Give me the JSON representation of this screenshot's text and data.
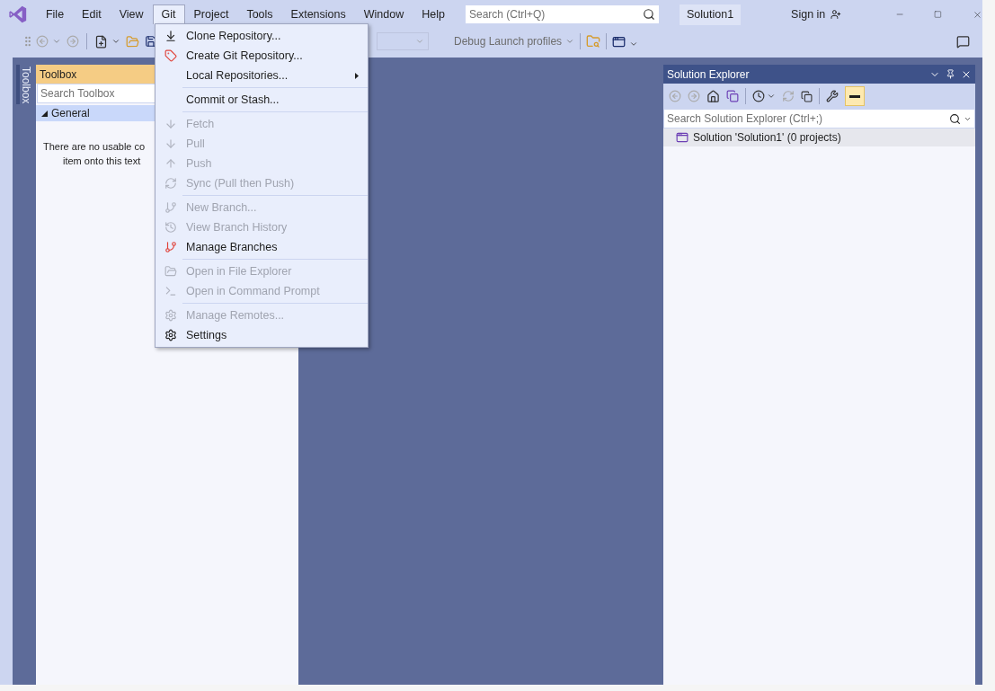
{
  "title_bar": {
    "menus": [
      {
        "label": "File",
        "selected": false
      },
      {
        "label": "Edit",
        "selected": false
      },
      {
        "label": "View",
        "selected": false
      },
      {
        "label": "Git",
        "selected": true
      },
      {
        "label": "Project",
        "selected": false
      },
      {
        "label": "Tools",
        "selected": false
      },
      {
        "label": "Extensions",
        "selected": false
      },
      {
        "label": "Window",
        "selected": false
      },
      {
        "label": "Help",
        "selected": false
      }
    ],
    "search": {
      "placeholder": "Search (Ctrl+Q)"
    },
    "solution_name": "Solution1",
    "sign_in": "Sign in"
  },
  "toolbar": {
    "launch_profiles": "Debug Launch profiles"
  },
  "git_menu": {
    "groups": [
      [
        {
          "label": "Clone Repository...",
          "disabled": false,
          "submenu": false
        },
        {
          "label": "Create Git Repository...",
          "disabled": false,
          "submenu": false
        },
        {
          "label": "Local Repositories...",
          "disabled": false,
          "submenu": true
        }
      ],
      [
        {
          "label": "Commit or Stash...",
          "disabled": false,
          "submenu": false
        }
      ],
      [
        {
          "label": "Fetch",
          "disabled": true,
          "submenu": false
        },
        {
          "label": "Pull",
          "disabled": true,
          "submenu": false
        },
        {
          "label": "Push",
          "disabled": true,
          "submenu": false
        },
        {
          "label": "Sync (Pull then Push)",
          "disabled": true,
          "submenu": false
        }
      ],
      [
        {
          "label": "New Branch...",
          "disabled": true,
          "submenu": false
        },
        {
          "label": "View Branch History",
          "disabled": true,
          "submenu": false
        },
        {
          "label": "Manage Branches",
          "disabled": false,
          "submenu": false
        }
      ],
      [
        {
          "label": "Open in File Explorer",
          "disabled": true,
          "submenu": false
        },
        {
          "label": "Open in Command Prompt",
          "disabled": true,
          "submenu": false
        }
      ],
      [
        {
          "label": "Manage Remotes...",
          "disabled": true,
          "submenu": false
        },
        {
          "label": "Settings",
          "disabled": false,
          "submenu": false
        }
      ]
    ]
  },
  "side_tab": "Toolbox",
  "toolbox": {
    "title": "Toolbox",
    "search": {
      "placeholder": "Search Toolbox"
    },
    "group": {
      "label": "General",
      "expanded": true
    },
    "message_lines": [
      "There are no usable co",
      "item onto this text"
    ]
  },
  "solution_explorer": {
    "title": "Solution Explorer",
    "search": {
      "placeholder": "Search Solution Explorer (Ctrl+;)"
    },
    "show_all_active": true,
    "tree": [
      {
        "label": "Solution 'Solution1' (0 projects)",
        "selected": true
      }
    ]
  }
}
